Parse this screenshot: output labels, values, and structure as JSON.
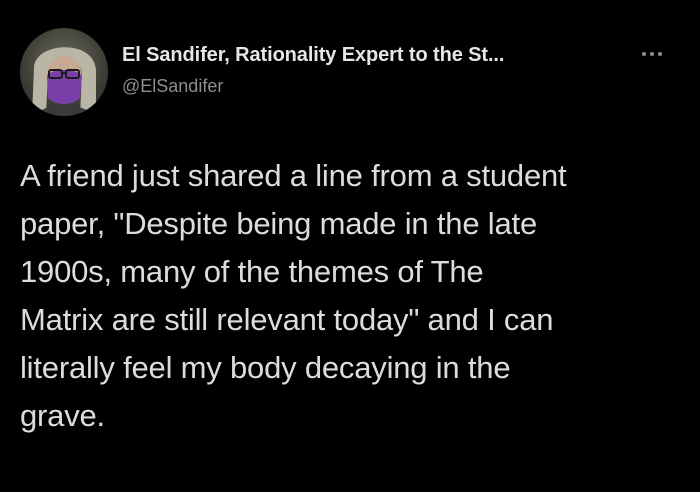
{
  "tweet": {
    "author": {
      "display_name": "El Sandifer, Rationality Expert to the St...",
      "handle": "@ElSandifer"
    },
    "body_lines": [
      "A friend just shared a line from a student",
      "paper, \"Despite being made in the late",
      "1900s, many of the themes of The",
      "Matrix are still relevant today\" and I can",
      "literally feel my body decaying in the",
      "grave."
    ]
  },
  "icons": {
    "more": "more-dots-icon",
    "avatar": "avatar-image"
  },
  "colors": {
    "background": "#000000",
    "name": "#e6e6e6",
    "handle": "#8a8f94",
    "body": "#dcdcdc",
    "avatar_accent": "#7a3fa8"
  }
}
